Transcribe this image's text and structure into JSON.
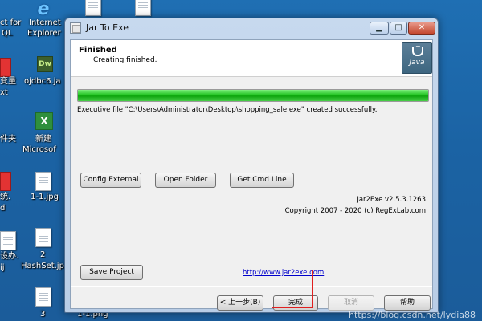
{
  "desktop": {
    "icons": [
      {
        "label": "ct for"
      },
      {
        "label": "QL"
      },
      {
        "label": "Internet"
      },
      {
        "label": "Explorer"
      },
      {
        "label": "变量"
      },
      {
        "label": "xt"
      },
      {
        "label": "ojdbc6.ja"
      },
      {
        "label": "件夹"
      },
      {
        "label": "新建"
      },
      {
        "label": "Microsof"
      },
      {
        "label": "统."
      },
      {
        "label": "d"
      },
      {
        "label": "1-1.jpg"
      },
      {
        "label": "设办."
      },
      {
        "label": "ij"
      },
      {
        "label": "2"
      },
      {
        "label": "HashSet.jp"
      },
      {
        "label": "3"
      },
      {
        "label": "1-1.png"
      }
    ],
    "dw_icon_text": "Dw"
  },
  "window": {
    "title": "Jar To Exe",
    "controls": {
      "minimize": "▁",
      "maximize": "□",
      "close": "✕"
    }
  },
  "header": {
    "title": "Finished",
    "subtitle": "Creating finished.",
    "logo_text": "Java"
  },
  "progress": {
    "percent": 100,
    "color": "#22c322"
  },
  "status": "Executive file \"C:\\Users\\Administrator\\Desktop\\shopping_sale.exe\" created successfully.",
  "buttons": {
    "config_external": "Config External",
    "open_folder": "Open Folder",
    "get_cmd_line": "Get Cmd Line",
    "save_project": "Save Project",
    "prev": "< 上一步(B)",
    "finish": "完成",
    "cancel": "取消",
    "help": "帮助"
  },
  "version": "Jar2Exe v2.5.3.1263",
  "copyright": "Copyright 2007 - 2020 (c) RegExLab.com",
  "link": "http://www.jar2exe.com",
  "watermark": "https://blog.csdn.net/lydia88",
  "colors": {
    "highlight": "#e02020",
    "link": "#0000cc"
  }
}
